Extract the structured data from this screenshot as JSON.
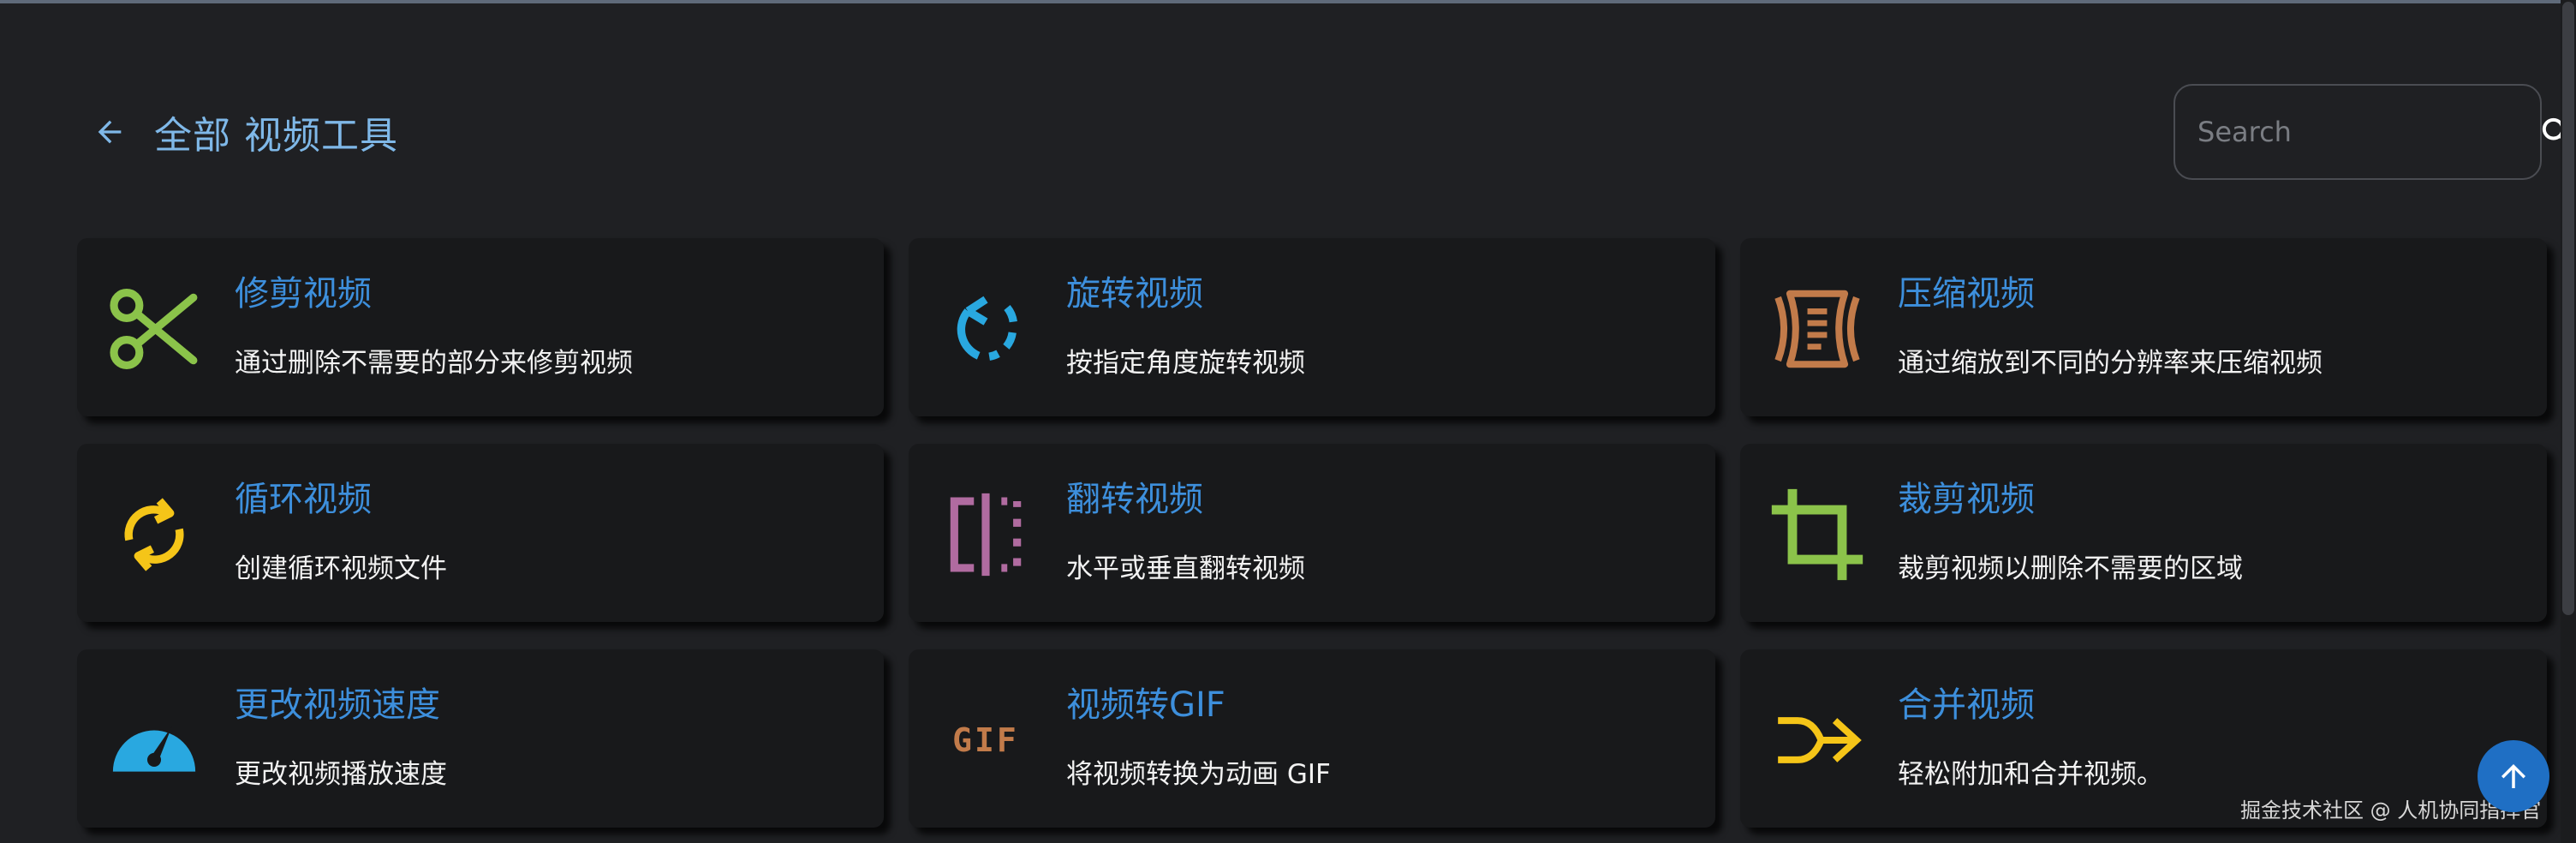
{
  "header": {
    "title": "全部 视频工具",
    "back_icon": "arrow-left-icon"
  },
  "search": {
    "placeholder": "Search",
    "value": "",
    "icon": "search-icon"
  },
  "colors": {
    "background": "#1f2023",
    "card": "#18191b",
    "title_blue": "#7fb8e8",
    "card_title_blue": "#3d8fdc",
    "fab_blue": "#1f6fc4"
  },
  "tools": [
    {
      "name": "修剪视频",
      "desc": "通过删除不需要的部分来修剪视频",
      "icon": "scissors-icon",
      "color": "#8bc34a"
    },
    {
      "name": "旋转视频",
      "desc": "按指定角度旋转视频",
      "icon": "rotate-icon",
      "color": "#29a8e0"
    },
    {
      "name": "压缩视频",
      "desc": "通过缩放到不同的分辨率来压缩视频",
      "icon": "compress-icon",
      "color": "#c27b4a"
    },
    {
      "name": "循环视频",
      "desc": "创建循环视频文件",
      "icon": "loop-icon",
      "color": "#f5c518"
    },
    {
      "name": "翻转视频",
      "desc": "水平或垂直翻转视频",
      "icon": "flip-icon",
      "color": "#b06ba0"
    },
    {
      "name": "裁剪视频",
      "desc": "裁剪视频以删除不需要的区域",
      "icon": "crop-icon",
      "color": "#8bc34a"
    },
    {
      "name": "更改视频速度",
      "desc": "更改视频播放速度",
      "icon": "speedometer-icon",
      "color": "#29a8e0"
    },
    {
      "name": "视频转GIF",
      "desc": "将视频转换为动画 GIF",
      "icon": "gif-icon",
      "icon_text": "GIF",
      "color": "#c27b4a"
    },
    {
      "name": "合并视频",
      "desc": "轻松附加和合并视频。",
      "icon": "merge-icon",
      "color": "#f5c518"
    }
  ],
  "watermark": "掘金技术社区 @ 人机协同指挥官",
  "scroll_top": {
    "icon": "arrow-up-icon"
  }
}
